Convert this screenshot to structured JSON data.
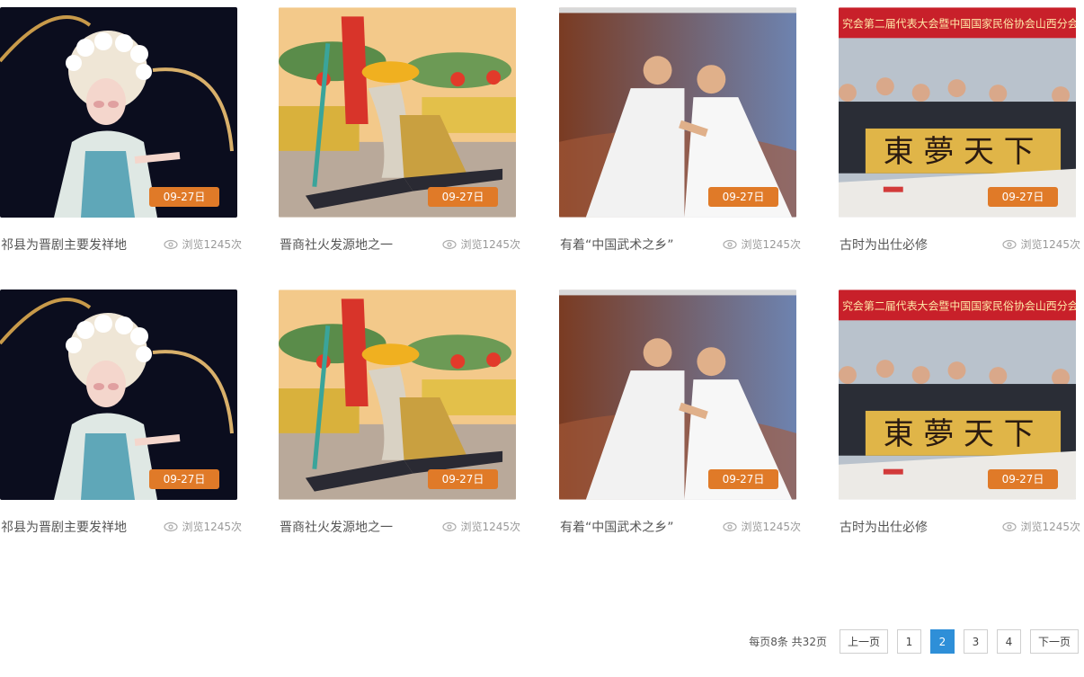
{
  "cards": [
    {
      "title": "祁县为晋剧主要发祥地",
      "date": "09-27日",
      "views": "浏览1245次",
      "scene": "opera-icon"
    },
    {
      "title": "晋商社火发源地之一",
      "date": "09-27日",
      "views": "浏览1245次",
      "scene": "shehuo-icon"
    },
    {
      "title": "有着“中国武术之乡”",
      "date": "09-27日",
      "views": "浏览1245次",
      "scene": "martial-arts-icon"
    },
    {
      "title": "古时为出仕必修",
      "date": "09-27日",
      "views": "浏览1245次",
      "scene": "calligraphy-icon",
      "banner": "究会第二届代表大会暨中国国家民俗协会山西分会成立"
    },
    {
      "title": "祁县为晋剧主要发祥地",
      "date": "09-27日",
      "views": "浏览1245次",
      "scene": "opera-icon"
    },
    {
      "title": "晋商社火发源地之一",
      "date": "09-27日",
      "views": "浏览1245次",
      "scene": "shehuo-icon"
    },
    {
      "title": "有着“中国武术之乡”",
      "date": "09-27日",
      "views": "浏览1245次",
      "scene": "martial-arts-icon"
    },
    {
      "title": "古时为出仕必修",
      "date": "09-27日",
      "views": "浏览1245次",
      "scene": "calligraphy-icon",
      "banner": "究会第二届代表大会暨中国国家民俗协会山西分会成立"
    }
  ],
  "pagination": {
    "info": "每页8条 共32页",
    "prev": "上一页",
    "pages": [
      "1",
      "2",
      "3",
      "4"
    ],
    "current": "2",
    "next": "下一页"
  },
  "colors": {
    "badge": "#e07a28",
    "active_page": "#2e8fd8"
  }
}
